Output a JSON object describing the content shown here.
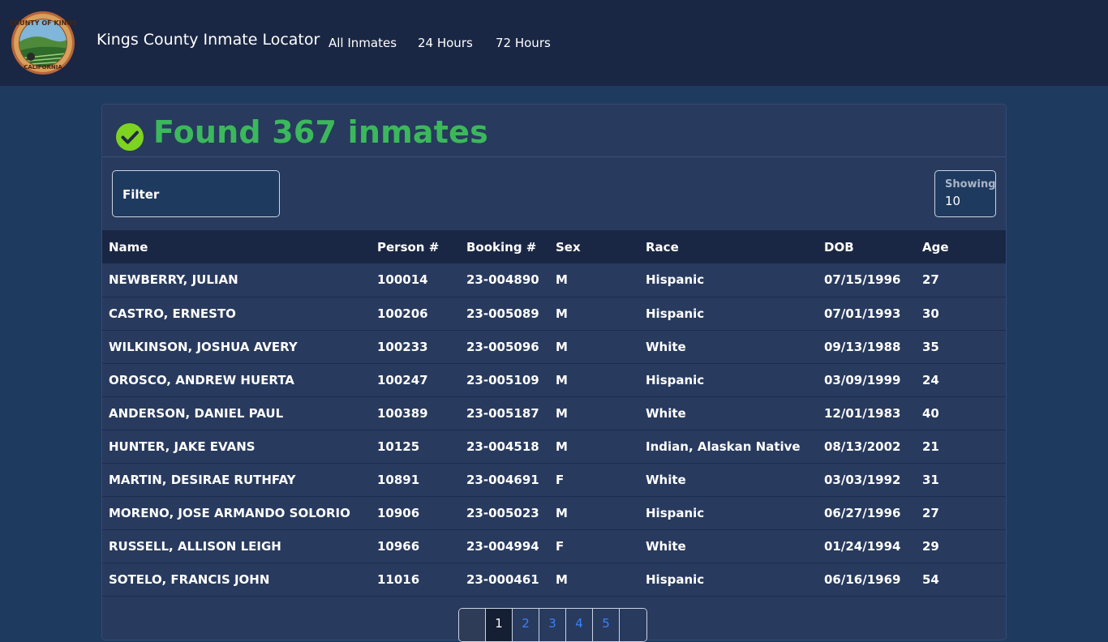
{
  "navbar": {
    "logo_text": "COUNTY OF KINGS CALIFORNIA",
    "brand": "Kings County Inmate Locator",
    "links": [
      "All Inmates",
      "24 Hours",
      "72 Hours"
    ]
  },
  "header": {
    "title": "Found 367 inmates"
  },
  "filter": {
    "label": "Filter"
  },
  "showing": {
    "label": "Showing",
    "value": "10"
  },
  "table": {
    "columns": [
      "Name",
      "Person #",
      "Booking #",
      "Sex",
      "Race",
      "DOB",
      "Age"
    ],
    "rows": [
      [
        "NEWBERRY, JULIAN",
        "100014",
        "23-004890",
        "M",
        "Hispanic",
        "07/15/1996",
        "27"
      ],
      [
        "CASTRO, ERNESTO",
        "100206",
        "23-005089",
        "M",
        "Hispanic",
        "07/01/1993",
        "30"
      ],
      [
        "WILKINSON, JOSHUA AVERY",
        "100233",
        "23-005096",
        "M",
        "White",
        "09/13/1988",
        "35"
      ],
      [
        "OROSCO, ANDREW HUERTA",
        "100247",
        "23-005109",
        "M",
        "Hispanic",
        "03/09/1999",
        "24"
      ],
      [
        "ANDERSON, DANIEL PAUL",
        "100389",
        "23-005187",
        "M",
        "White",
        "12/01/1983",
        "40"
      ],
      [
        "HUNTER, JAKE EVANS",
        "10125",
        "23-004518",
        "M",
        "Indian, Alaskan Native",
        "08/13/2002",
        "21"
      ],
      [
        "MARTIN, DESIRAE RUTHFAY",
        "10891",
        "23-004691",
        "F",
        "White",
        "03/03/1992",
        "31"
      ],
      [
        "MORENO, JOSE ARMANDO SOLORIO",
        "10906",
        "23-005023",
        "M",
        "Hispanic",
        "06/27/1996",
        "27"
      ],
      [
        "RUSSELL, ALLISON LEIGH",
        "10966",
        "23-004994",
        "F",
        "White",
        "01/24/1994",
        "29"
      ],
      [
        "SOTELO, FRANCIS JOHN",
        "11016",
        "23-000461",
        "M",
        "Hispanic",
        "06/16/1969",
        "54"
      ]
    ]
  },
  "pagination": {
    "pages": [
      "1",
      "2",
      "3",
      "4",
      "5"
    ],
    "active": "1"
  },
  "colors": {
    "navbar_bg": "#1a2744",
    "page_bg": "#1f3a5f",
    "card_bg": "#283a5e",
    "success": "#3cb85c",
    "check_icon": "#7ed321",
    "link_blue": "#3b82f6"
  },
  "icons": {
    "logo": "county-seal-icon",
    "check": "check-circle-icon"
  }
}
